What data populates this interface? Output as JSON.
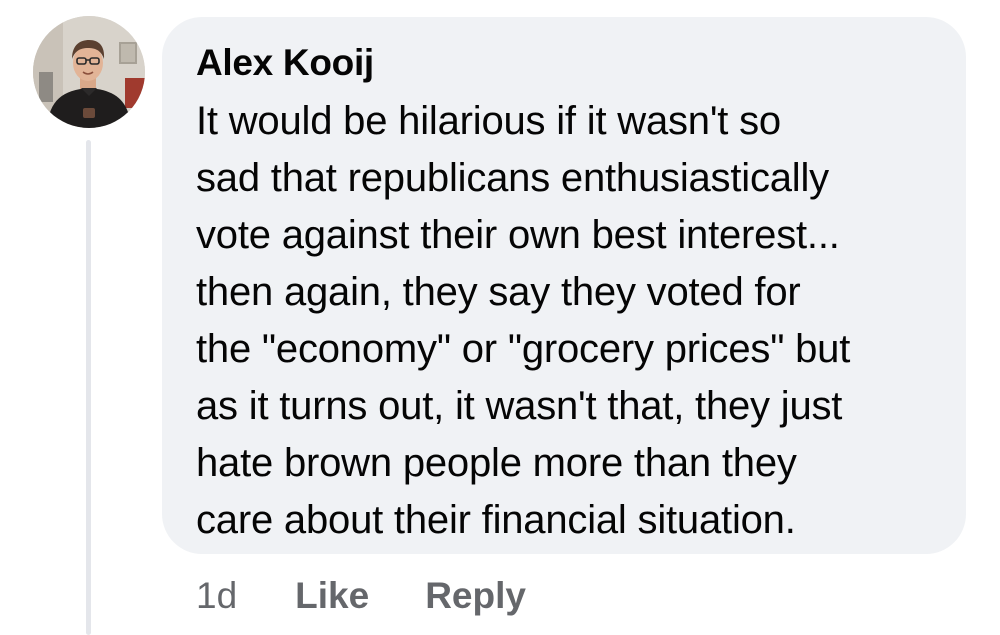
{
  "comment": {
    "author": "Alex Kooij",
    "text": "It would be hilarious if it wasn't so\nsad that republicans enthusiastically\nvote against their own best interest...\nthen again, they say they voted for\nthe \"economy\" or \"grocery prices\" but\nas it turns out, it wasn't that, they just\nhate brown people more than they\ncare about their financial situation.",
    "avatar_icon": "user-profile-photo"
  },
  "actions": {
    "timestamp": "1d",
    "like_label": "Like",
    "reply_label": "Reply"
  },
  "colors": {
    "bubble_background": "#f0f2f5",
    "text_primary": "#050505",
    "text_secondary": "#65676b",
    "thread_line": "#e4e6eb"
  }
}
